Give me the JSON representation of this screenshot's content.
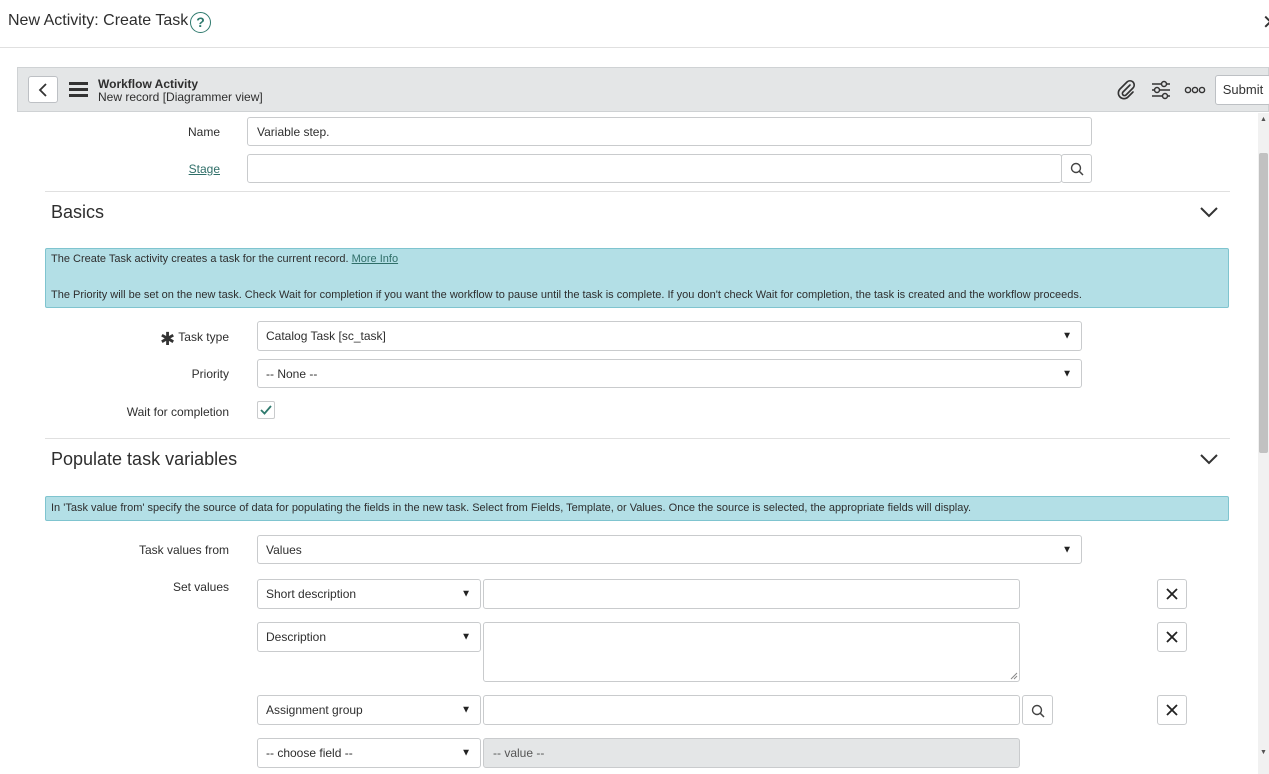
{
  "modal": {
    "title": "New Activity: Create Task",
    "help_glyph": "?",
    "close_glyph": "✕"
  },
  "form_header": {
    "title": "Workflow Activity",
    "subtitle": "New record [Diagrammer view]",
    "back_glyph": "<",
    "submit_label": "Submit"
  },
  "fields": {
    "name_label": "Name",
    "name_value": "Variable step.",
    "stage_label": "Stage",
    "stage_value": ""
  },
  "basics": {
    "title": "Basics",
    "info_text": "The Create Task activity creates a task for the current record.",
    "info_link": "More Info",
    "info_text2": "The Priority will be set on the new task. Check Wait for completion if you want the workflow to pause until the task is complete. If you don't check Wait for completion, the task is created and the workflow proceeds.",
    "task_type_label": "Task type",
    "task_type_value": "Catalog Task [sc_task]",
    "priority_label": "Priority",
    "priority_value": "-- None --",
    "wait_label": "Wait for completion",
    "wait_checked": true
  },
  "populate": {
    "title": "Populate task variables",
    "info_text": "In 'Task value from' specify the source of data for populating the fields in the new task. Select from Fields, Template, or Values. Once the source is selected, the appropriate fields will display.",
    "values_from_label": "Task values from",
    "values_from_value": "Values",
    "set_values_label": "Set values",
    "rows": [
      {
        "field": "Short description",
        "value": ""
      },
      {
        "field": "Description",
        "value": ""
      },
      {
        "field": "Assignment group",
        "value": ""
      },
      {
        "field": "-- choose field --",
        "value": "-- value --"
      }
    ]
  },
  "colors": {
    "accent": "#2f7a6e",
    "info_bg": "#b3dfe6",
    "header_bg": "#e4e6e7"
  }
}
